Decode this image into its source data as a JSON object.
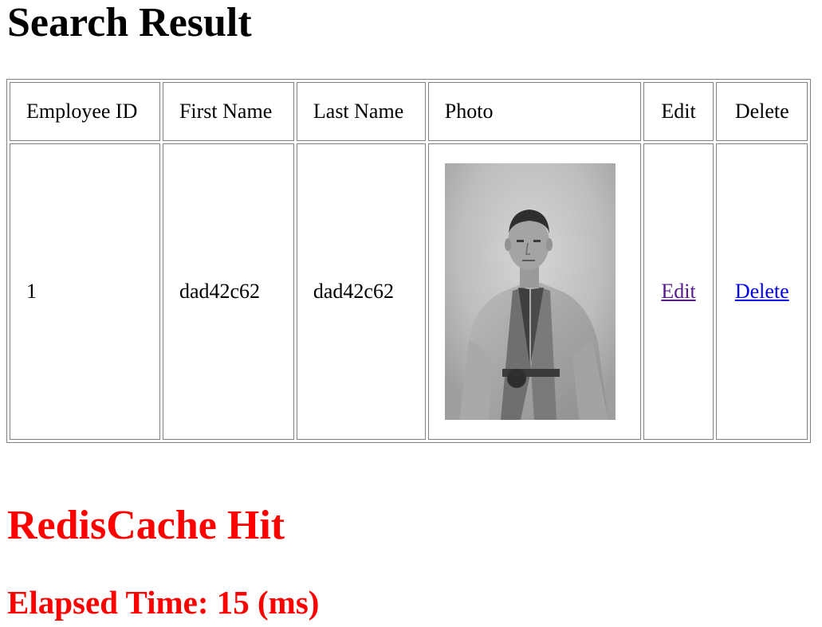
{
  "page": {
    "title": "Search Result"
  },
  "table": {
    "headers": {
      "employee_id": "Employee ID",
      "first_name": "First Name",
      "last_name": "Last Name",
      "photo": "Photo",
      "edit": "Edit",
      "delete": "Delete"
    },
    "rows": [
      {
        "employee_id": "1",
        "first_name": "dad42c62",
        "last_name": "dad42c62",
        "photo": "employee-portrait",
        "edit_label": "Edit",
        "delete_label": "Delete"
      }
    ]
  },
  "cache": {
    "status": "RedisCache Hit",
    "elapsed": "Elapsed Time: 15 (ms)"
  },
  "colors": {
    "alert_red": "#ff0000",
    "visited_link": "#551a8b",
    "link": "#0000ee",
    "table_border": "#808080"
  }
}
